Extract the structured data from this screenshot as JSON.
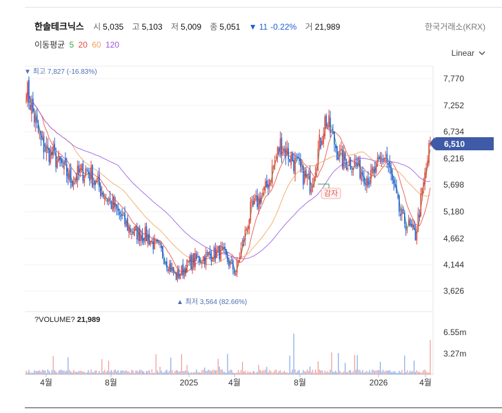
{
  "stock": {
    "name": "한솔테크닉스",
    "open_label": "시",
    "open": "5,035",
    "high_label": "고",
    "high": "5,103",
    "low_label": "저",
    "low": "5,009",
    "close_label": "종",
    "close": "5,051",
    "change_arrow": "▼",
    "change": "11",
    "change_pct": "-0.22%",
    "volume_label": "거",
    "volume": "21,989"
  },
  "exchange": "한국거래소(KRX)",
  "scale": {
    "label": "Linear"
  },
  "moving_averages": {
    "label": "이동평균",
    "periods": [
      {
        "value": "5",
        "color": "#3aa64f"
      },
      {
        "value": "20",
        "color": "#e74c3c"
      },
      {
        "value": "60",
        "color": "#f0a35a"
      },
      {
        "value": "120",
        "color": "#9b59e0"
      }
    ]
  },
  "colors": {
    "up": "#e0463a",
    "down": "#1e5fd6",
    "badge": "#3f5aa7",
    "ma_grid": "#ececec"
  },
  "chart_data": {
    "type": "candlestick",
    "y_ticks": [
      "7,770",
      "7,252",
      "6,734",
      "6,216",
      "5,698",
      "5,180",
      "4,662",
      "4,144",
      "3,626"
    ],
    "ylim": [
      3500,
      7900
    ],
    "x_ticks": [
      "4월",
      "8월",
      "2025",
      "4월",
      "8월",
      "2026",
      "4월"
    ],
    "current_price": "6,510",
    "max_annotation": {
      "marker": "▼",
      "text": "최고",
      "value": "7,827",
      "pct": "(-16.83%)"
    },
    "min_annotation": {
      "marker": "▲",
      "text": "최저",
      "value": "3,564",
      "pct": "(82.66%)"
    },
    "event_label": "감자",
    "volume": {
      "label": "?VOLUME?",
      "value": "21,989",
      "y_ticks": [
        "6.55m",
        "3.27m"
      ]
    },
    "price_path": [
      [
        "2024-02",
        7600
      ],
      [
        "2024-03",
        6500
      ],
      [
        "2024-04",
        6200
      ],
      [
        "2024-05",
        5800
      ],
      [
        "2024-06",
        6000
      ],
      [
        "2024-07",
        5600
      ],
      [
        "2024-08",
        5200
      ],
      [
        "2024-09",
        4800
      ],
      [
        "2024-10",
        4700
      ],
      [
        "2024-11",
        4400
      ],
      [
        "2024-12",
        3900
      ],
      [
        "2025-01",
        4200
      ],
      [
        "2025-02",
        4300
      ],
      [
        "2025-03",
        4400
      ],
      [
        "2025-04",
        4000
      ],
      [
        "2025-05",
        5200
      ],
      [
        "2025-06",
        5600
      ],
      [
        "2025-07",
        6500
      ],
      [
        "2025-08",
        6100
      ],
      [
        "2025-09",
        5700
      ],
      [
        "2025-10",
        7000
      ],
      [
        "2025-11",
        6200
      ],
      [
        "2025-12",
        6100
      ],
      [
        "2026-01",
        5800
      ],
      [
        "2026-02",
        6300
      ],
      [
        "2026-03",
        5100
      ],
      [
        "2026-04",
        4700
      ],
      [
        "2026-04",
        6510
      ]
    ]
  }
}
